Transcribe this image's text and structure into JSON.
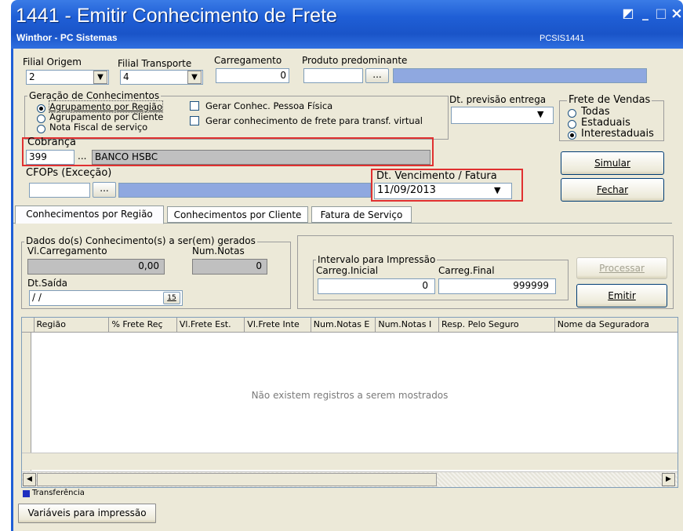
{
  "window": {
    "title": "1441 - Emitir Conhecimento de Frete",
    "subtitle": "Winthor - PC Sistemas",
    "program_code": "PCSIS1441",
    "controls": {
      "minimize": "_",
      "maximize": "□",
      "close": "×",
      "restore": "◩"
    }
  },
  "top": {
    "filial_origem": {
      "label": "Filial Origem",
      "value": "2"
    },
    "filial_transporte": {
      "label": "Filial Transporte",
      "value": "4"
    },
    "carregamento": {
      "label": "Carregamento",
      "value": "0"
    },
    "produto": {
      "label": "Produto predominante",
      "value": "",
      "button": "..."
    }
  },
  "geracao": {
    "label": "Geração de Conhecimentos",
    "options": [
      "Agrupamento por Região",
      "Agrupamento por Cliente",
      "Nota Fiscal de serviço"
    ],
    "selected": 0,
    "checks": [
      "Gerar Conhec. Pessoa Física",
      "Gerar conhecimento de frete para transf. virtual"
    ]
  },
  "dt_previsao": {
    "label": "Dt. previsão entrega",
    "value": ""
  },
  "frete_vendas": {
    "label": "Frete de Vendas",
    "options": [
      "Todas",
      "Estaduais",
      "Interestaduais"
    ],
    "selected": 2
  },
  "cobranca": {
    "label": "Cobrança",
    "code": "399",
    "button": "...",
    "name": "BANCO HSBC"
  },
  "cfops": {
    "label": "CFOPs  (Exceção)",
    "value": "",
    "button": "..."
  },
  "dt_vencimento": {
    "label": "Dt. Vencimento / Fatura",
    "value": "11/09/2013"
  },
  "buttons": {
    "simular": "Simular",
    "fechar": "Fechar",
    "processar": "Processar",
    "emitir": "Emitir",
    "variaveis": "Variáveis para impressão"
  },
  "tabs": [
    "Conhecimentos por Região",
    "Conhecimentos por Cliente",
    "Fatura de Serviço"
  ],
  "dados": {
    "label": "Dados do(s) Conhecimento(s) a ser(em) gerados",
    "vl_carregamento": {
      "label": "Vl.Carregamento",
      "value": "0,00"
    },
    "num_notas": {
      "label": "Num.Notas",
      "value": "0"
    },
    "dt_saida": {
      "label": "Dt.Saída",
      "value": " / /",
      "calendar": "15"
    }
  },
  "intervalo": {
    "label": "Intervalo para Impressão",
    "inicial": {
      "label": "Carreg.Inicial",
      "value": "0"
    },
    "final": {
      "label": "Carreg.Final",
      "value": "999999"
    }
  },
  "grid": {
    "columns": [
      "Região",
      "% Frete Reç",
      "Vl.Frete Est.",
      "Vl.Frete Inte",
      "Num.Notas E",
      "Num.Notas I",
      "Resp. Pelo Seguro",
      "Nome da Seguradora"
    ],
    "empty_message": "Não existem registros a serem mostrados"
  },
  "legend": {
    "label": "Transferência",
    "color": "#1f2fbf"
  },
  "colors": {
    "titlebar": "#1f5fd6",
    "window_bg": "#ece9d8",
    "highlight_red": "#e03030",
    "blue_field": "#8fa8e0"
  }
}
